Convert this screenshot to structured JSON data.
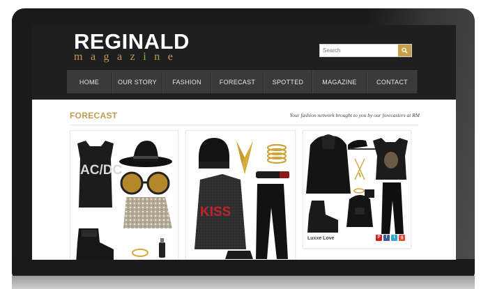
{
  "site": {
    "logo_title": "REGINALD",
    "logo_subtitle": "magazine"
  },
  "search": {
    "placeholder": "Search",
    "icon": "search-icon"
  },
  "nav": {
    "items": [
      "HOME",
      "OUR STORY",
      "FASHION",
      "FORECAST",
      "SPOTTED",
      "MAGAZINE",
      "CONTACT"
    ]
  },
  "main": {
    "section_title": "FORECAST",
    "tagline": "Your fashion network brought to you by our forecasters at RM",
    "cards": [
      {
        "caption": "",
        "text": [
          "AC/DC"
        ]
      },
      {
        "caption": "",
        "text": [
          "KISS"
        ]
      },
      {
        "caption": "Luxxe Love",
        "shares": [
          "pinterest-icon",
          "facebook-icon",
          "twitter-icon",
          "google-plus-icon"
        ]
      }
    ]
  },
  "colors": {
    "accent": "#c19a4f",
    "header_bg": "#1f1f1f",
    "nav_bg": "#3a3a3a"
  }
}
